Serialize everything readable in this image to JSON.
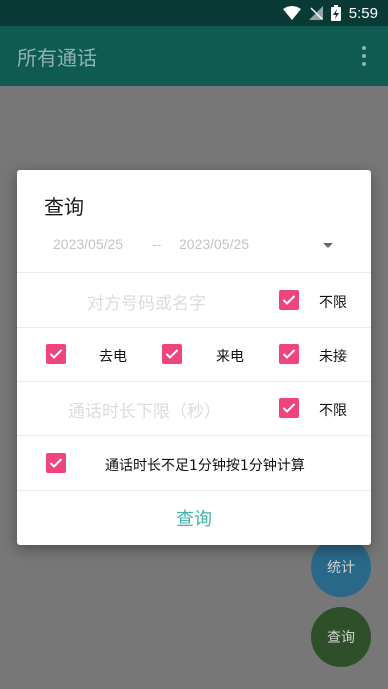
{
  "status_bar": {
    "time": "5:59"
  },
  "app_bar": {
    "title": "所有通话"
  },
  "fabs": {
    "stats_label": "统计",
    "query_label": "查询"
  },
  "dialog": {
    "title": "查询",
    "date_range": {
      "start": "2023/05/25",
      "separator": "--",
      "end": "2023/05/25"
    },
    "contact_row": {
      "placeholder": "对方号码或名字",
      "checkbox_label": "不限",
      "checked": true
    },
    "call_type_row": {
      "outgoing": {
        "label": "去电",
        "checked": true
      },
      "incoming": {
        "label": "来电",
        "checked": true
      },
      "missed": {
        "label": "未接",
        "checked": true
      }
    },
    "duration_row": {
      "placeholder": "通话时长下限（秒）",
      "checkbox_label": "不限",
      "checked": true
    },
    "rounding_row": {
      "label": "通话时长不足1分钟按1分钟计算",
      "checked": true
    },
    "query_button": "查询"
  },
  "colors": {
    "accent": "#f0457c",
    "primary": "#3fb5a6",
    "app_bar": "#0f5b52"
  }
}
